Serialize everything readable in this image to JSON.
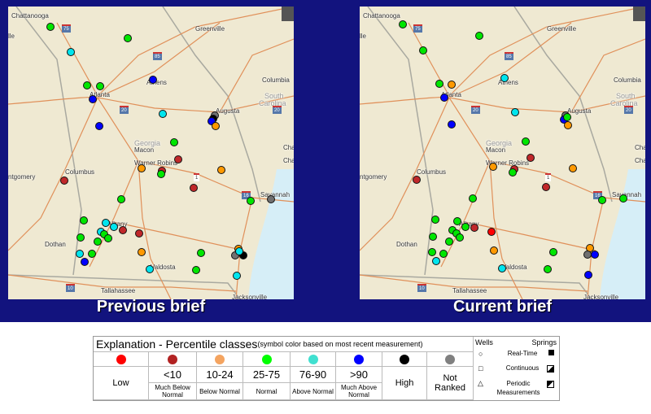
{
  "maps": [
    {
      "caption": "Previous brief"
    },
    {
      "caption": "Current brief"
    }
  ],
  "cities": [
    "Chattanooga",
    "Greenville",
    "Athens",
    "Atlanta",
    "Columbia",
    "South",
    "Carolina",
    "Augusta",
    "Georgia",
    "Macon",
    "Warner Robins",
    "Columbus",
    "ntgomery",
    "Savannah",
    "Albany",
    "Dothan",
    "Valdosta",
    "Tallahassee",
    "Jacksonville",
    "Cha",
    "Cha",
    "lle"
  ],
  "highway_shields": [
    "75",
    "85",
    "20",
    "20",
    "16",
    "10",
    "1"
  ],
  "legend": {
    "title": "Explanation - Percentile classes",
    "subtitle": "(symbol color based on most recent measurement)",
    "classes": [
      {
        "value": "Low",
        "sub": "",
        "color": "#ff0000"
      },
      {
        "value": "<10",
        "sub": "Much Below Normal",
        "color": "#b22222"
      },
      {
        "value": "10-24",
        "sub": "Below Normal",
        "color": "#f4a460"
      },
      {
        "value": "25-75",
        "sub": "Normal",
        "color": "#00ff00"
      },
      {
        "value": "76-90",
        "sub": "Above Normal",
        "color": "#40e0d0"
      },
      {
        "value": ">90",
        "sub": "Much Above Normal",
        "color": "#0000ff"
      },
      {
        "value": "High",
        "sub": "",
        "color": "#000000"
      },
      {
        "value": "Not Ranked",
        "sub": "",
        "color": "#808080"
      }
    ],
    "wells_label": "Wells",
    "springs_label": "Springs",
    "types": [
      "Real-Time",
      "Continuous",
      "Periodic Measurements"
    ]
  },
  "class_colors": {
    "r": "#ff0000",
    "d": "#c0282a",
    "o": "#ff9900",
    "g": "#00e600",
    "c": "#00e5ee",
    "b": "#0000ff",
    "k": "#000000",
    "x": "#707070"
  }
}
